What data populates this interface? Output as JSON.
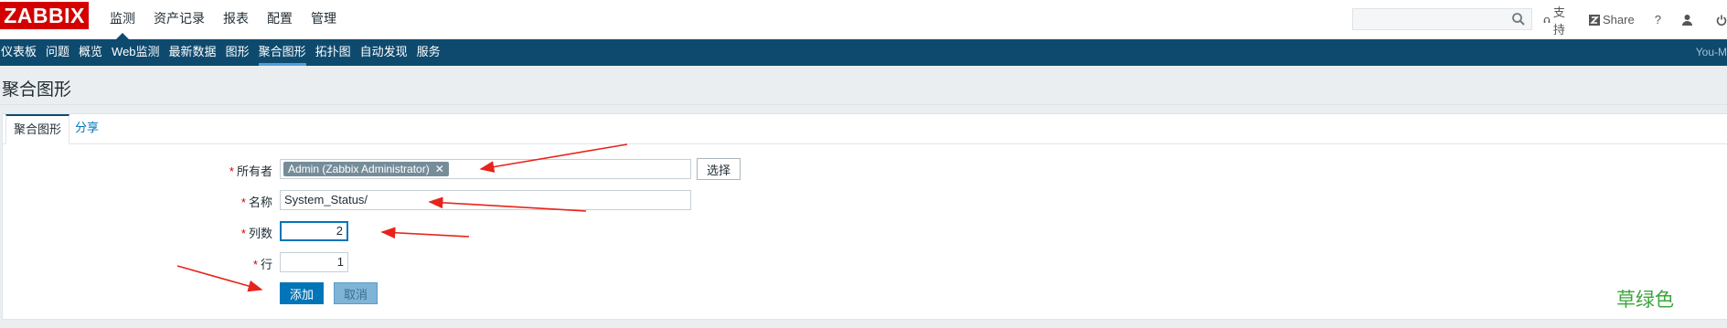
{
  "brand": {
    "logo_text": "ZABBIX",
    "color": "#d40000"
  },
  "main_menu": [
    {
      "label": "监测",
      "active": true
    },
    {
      "label": "资产记录"
    },
    {
      "label": "报表"
    },
    {
      "label": "配置"
    },
    {
      "label": "管理"
    }
  ],
  "top_right": {
    "search_placeholder": "",
    "support_label": "支持",
    "share_label": "Share",
    "help_label": "?"
  },
  "sub_menu": [
    {
      "label": "仪表板"
    },
    {
      "label": "问题"
    },
    {
      "label": "概览"
    },
    {
      "label": "Web监测"
    },
    {
      "label": "最新数据"
    },
    {
      "label": "图形"
    },
    {
      "label": "聚合图形",
      "active": true
    },
    {
      "label": "拓扑图"
    },
    {
      "label": "自动发现"
    },
    {
      "label": "服务"
    }
  ],
  "sub_menu_user": "You-M",
  "page": {
    "title": "聚合图形"
  },
  "tabs": [
    {
      "label": "聚合图形",
      "active": true
    },
    {
      "label": "分享"
    }
  ],
  "form": {
    "owner_label": "所有者",
    "owner_tag": "Admin (Zabbix Administrator)",
    "select_button": "选择",
    "name_label": "名称",
    "name_value": "System_Status/",
    "columns_label": "列数",
    "columns_value": "2",
    "rows_label": "行",
    "rows_value": "1",
    "add_button": "添加",
    "cancel_button": "取消"
  },
  "annotation_note": "草绿色",
  "colors": {
    "accent": "#0e4a6e",
    "link": "#0275b8",
    "required": "#d40000",
    "annotation": "#3aa63a",
    "arrow": "#e8231b"
  }
}
